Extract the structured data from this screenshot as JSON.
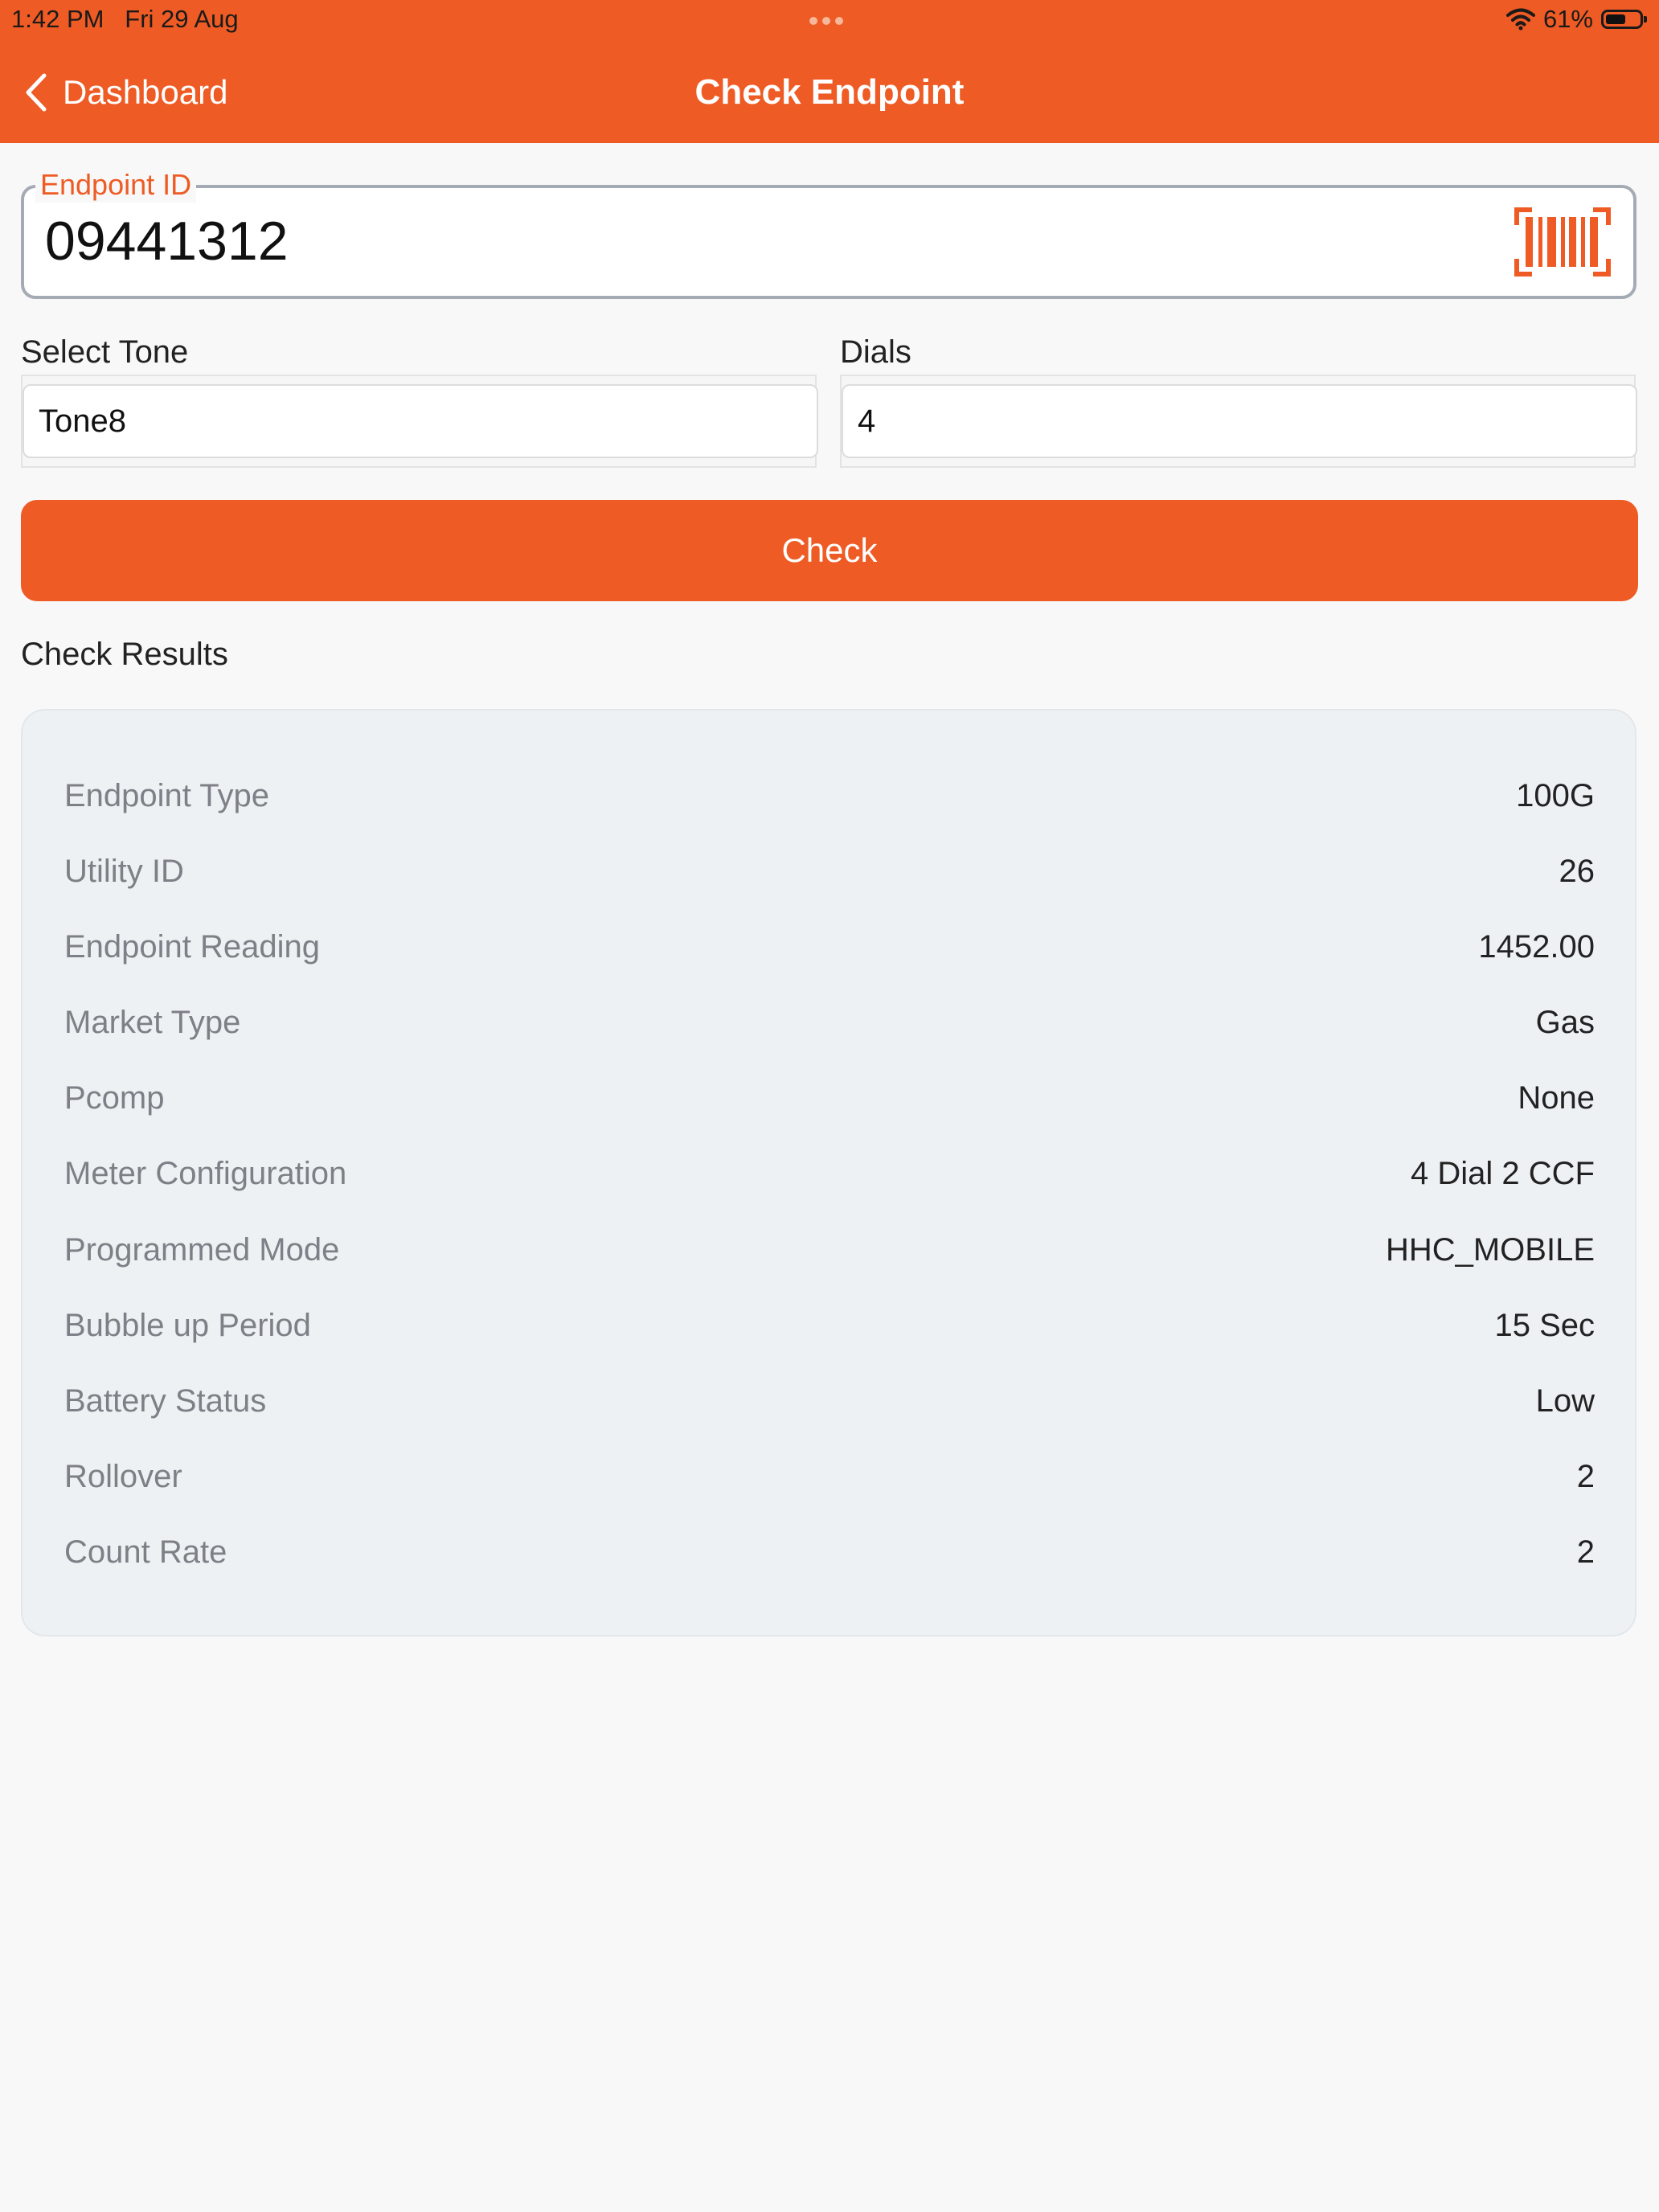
{
  "status_bar": {
    "time": "1:42 PM",
    "date": "Fri 29 Aug",
    "battery_percent": "61%",
    "battery_level": 0.61
  },
  "nav": {
    "back_label": "Dashboard",
    "title": "Check Endpoint"
  },
  "endpoint": {
    "label": "Endpoint ID",
    "value": "09441312"
  },
  "tone": {
    "label": "Select Tone",
    "value": "Tone8"
  },
  "dials": {
    "label": "Dials",
    "value": "4"
  },
  "check_button": "Check",
  "results": {
    "title": "Check Results",
    "rows": [
      {
        "key": "Endpoint Type",
        "value": "100G"
      },
      {
        "key": "Utility ID",
        "value": "26"
      },
      {
        "key": "Endpoint Reading",
        "value": "1452.00"
      },
      {
        "key": "Market Type",
        "value": "Gas"
      },
      {
        "key": "Pcomp",
        "value": "None"
      },
      {
        "key": "Meter Configuration",
        "value": "4 Dial 2 CCF"
      },
      {
        "key": "Programmed Mode",
        "value": "HHC_MOBILE"
      },
      {
        "key": "Bubble up Period",
        "value": "15 Sec"
      },
      {
        "key": "Battery Status",
        "value": "Low"
      },
      {
        "key": "Rollover",
        "value": "2"
      },
      {
        "key": "Count Rate",
        "value": "2"
      }
    ]
  },
  "colors": {
    "accent": "#ee5b24",
    "background": "#f8f8f8",
    "card": "#eef1f4"
  },
  "icons": [
    "chevron-left-icon",
    "barcode-scan-icon",
    "wifi-icon",
    "battery-icon"
  ]
}
